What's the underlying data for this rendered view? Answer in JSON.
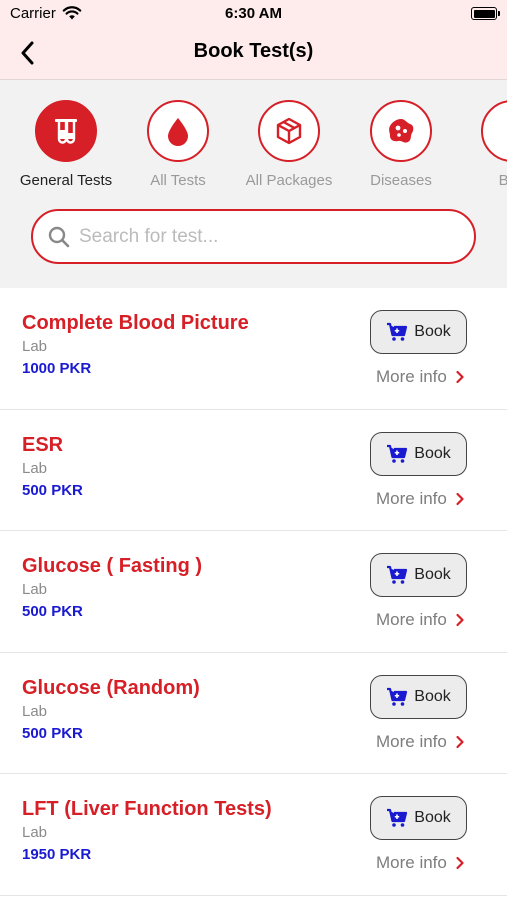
{
  "status": {
    "carrier": "Carrier",
    "time": "6:30 AM"
  },
  "nav": {
    "title": "Book Test(s)"
  },
  "categories": [
    {
      "label": "General Tests",
      "icon": "test-tubes-icon",
      "active": true
    },
    {
      "label": "All Tests",
      "icon": "blood-drop-icon",
      "active": false
    },
    {
      "label": "All Packages",
      "icon": "package-box-icon",
      "active": false
    },
    {
      "label": "Diseases",
      "icon": "virus-cell-icon",
      "active": false
    },
    {
      "label": "Boo",
      "icon": "partial-icon",
      "active": false
    }
  ],
  "search": {
    "placeholder": "Search for test..."
  },
  "tests": [
    {
      "name": "Complete Blood Picture",
      "type": "Lab",
      "price": "1000 PKR",
      "book_label": "Book",
      "more_info_label": "More info"
    },
    {
      "name": "ESR",
      "type": "Lab",
      "price": "500 PKR",
      "book_label": "Book",
      "more_info_label": "More info"
    },
    {
      "name": "Glucose ( Fasting )",
      "type": "Lab",
      "price": "500 PKR",
      "book_label": "Book",
      "more_info_label": "More info"
    },
    {
      "name": "Glucose (Random)",
      "type": "Lab",
      "price": "500 PKR",
      "book_label": "Book",
      "more_info_label": "More info"
    },
    {
      "name": "LFT (Liver Function Tests)",
      "type": "Lab",
      "price": "1950 PKR",
      "book_label": "Book",
      "more_info_label": "More info"
    }
  ],
  "colors": {
    "accent": "#d61f26",
    "price": "#1a1ad1",
    "header_bg": "#fdeceb",
    "panel_bg": "#f2f2f3",
    "cart": "#1a1ad1"
  }
}
